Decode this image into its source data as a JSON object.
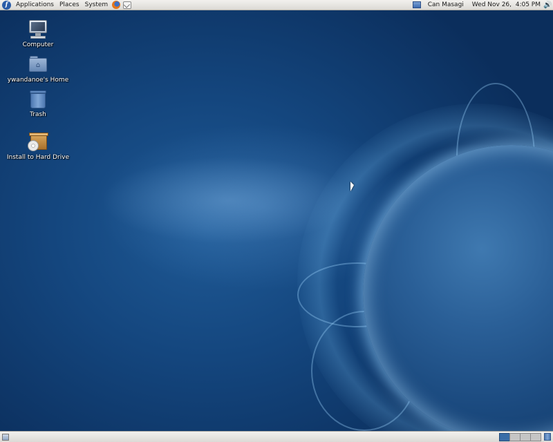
{
  "top_panel": {
    "menus": [
      "Applications",
      "Places",
      "System"
    ],
    "user_name": "Can Masagi",
    "clock": "Wed Nov 26,  4:05 PM"
  },
  "desktop": {
    "icons": [
      {
        "label": "Computer",
        "icon": "computer-icon"
      },
      {
        "label": "ywandanoe's Home",
        "icon": "home-folder-icon"
      },
      {
        "label": "Trash",
        "icon": "trash-icon"
      },
      {
        "label": "Install to Hard Drive",
        "icon": "install-icon"
      }
    ]
  },
  "bottom_panel": {
    "workspaces": 4,
    "active_workspace": 1
  },
  "colors": {
    "panel": "#dcdad5",
    "desktop_blue": "#14467e",
    "active_workspace": "#3a6ea8"
  }
}
